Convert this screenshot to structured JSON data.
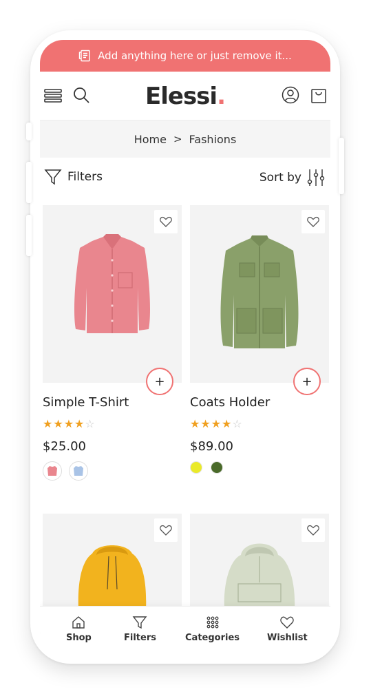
{
  "announcement": {
    "text": "Add anything here or just remove it..."
  },
  "header": {
    "logo_text": "Elessi",
    "logo_dot": ".",
    "menu_icon": "menu-icon",
    "search_icon": "search-icon",
    "account_icon": "user-icon",
    "cart_icon": "shopping-bag-icon"
  },
  "breadcrumb": {
    "items": [
      "Home",
      "Fashions"
    ],
    "separator": ">"
  },
  "toolbar": {
    "filters_label": "Filters",
    "sort_label": "Sort by"
  },
  "products": [
    {
      "name": "Simple T-Shirt",
      "rating": 4,
      "max_rating": 5,
      "price": "$25.00",
      "swatches": [
        "pink-shirt",
        "blue-shirt"
      ]
    },
    {
      "name": "Coats Holder",
      "rating": 4,
      "max_rating": 5,
      "price": "$89.00",
      "swatches": [
        "#eaea2a",
        "#4a6a2a"
      ]
    },
    {
      "name": "",
      "image": "yellow-hoodie"
    },
    {
      "name": "",
      "image": "sage-anorak"
    }
  ],
  "colors": {
    "accent": "#f07272",
    "star": "#f0a020"
  },
  "bottom_nav": [
    {
      "label": "Shop",
      "icon": "home-icon"
    },
    {
      "label": "Filters",
      "icon": "filter-icon"
    },
    {
      "label": "Categories",
      "icon": "grid-icon"
    },
    {
      "label": "Wishlist",
      "icon": "heart-icon"
    }
  ]
}
